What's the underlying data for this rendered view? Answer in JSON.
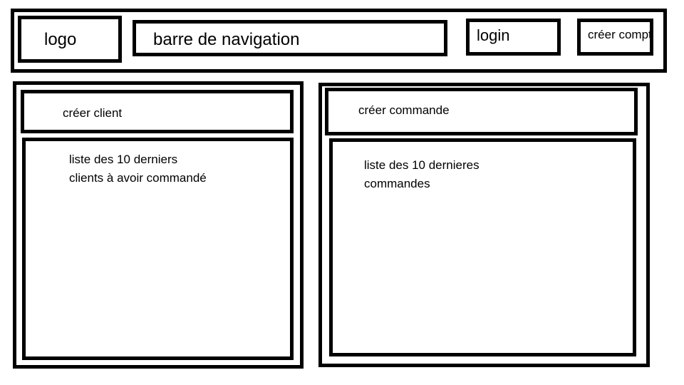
{
  "header": {
    "logo": "logo",
    "nav": "barre de navigation",
    "login": "login",
    "signup": "créer compte"
  },
  "left_panel": {
    "create_button": "créer client",
    "list_line1": "liste des 10 derniers",
    "list_line2": "clients à avoir commandé"
  },
  "right_panel": {
    "create_button": "créer commande",
    "list_line1": "liste des 10 dernieres",
    "list_line2": "commandes"
  }
}
